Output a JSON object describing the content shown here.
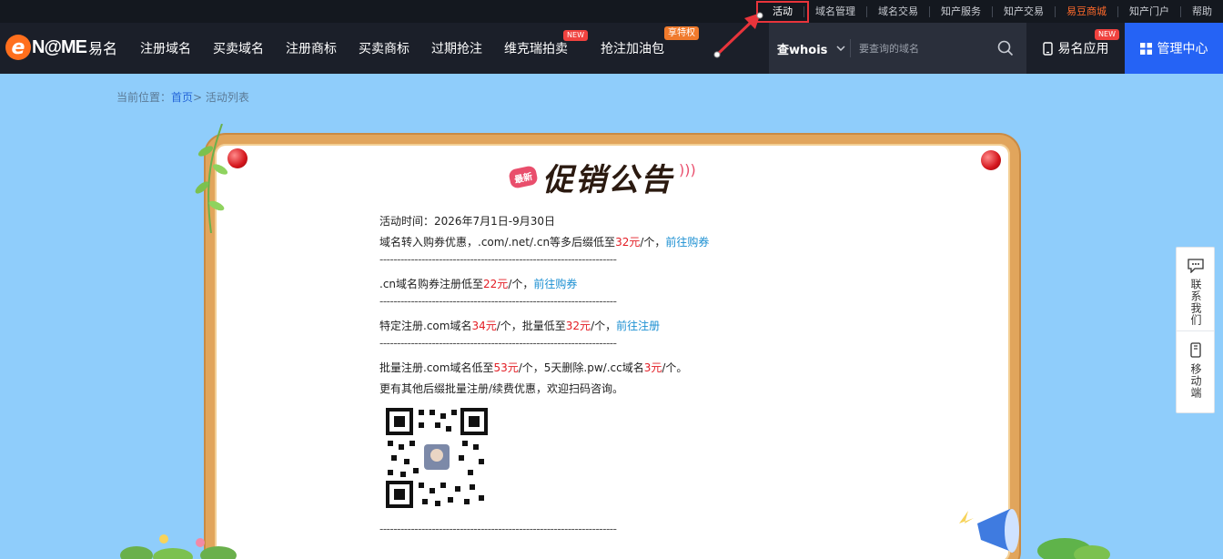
{
  "topbar": {
    "links": [
      {
        "label": "活动",
        "active": true
      },
      {
        "label": "域名管理"
      },
      {
        "label": "域名交易"
      },
      {
        "label": "知产服务"
      },
      {
        "label": "知产交易"
      },
      {
        "label": "易豆商城",
        "highlight": true
      },
      {
        "label": "知产门户"
      },
      {
        "label": "帮助"
      }
    ]
  },
  "logo": {
    "brand": "N@ME",
    "brand_cn": "易名",
    "letter": "e"
  },
  "nav": {
    "items": [
      {
        "label": "注册域名"
      },
      {
        "label": "买卖域名"
      },
      {
        "label": "注册商标"
      },
      {
        "label": "买卖商标"
      },
      {
        "label": "过期抢注"
      },
      {
        "label": "维克瑞拍卖",
        "badge": "NEW"
      },
      {
        "label": "抢注加油包",
        "badge": "享特权"
      }
    ]
  },
  "search": {
    "select_label": "查whois",
    "placeholder": "要查询的域名"
  },
  "app_button": {
    "label": "易名应用",
    "badge": "NEW"
  },
  "manage_button": {
    "label": "管理中心"
  },
  "breadcrumb": {
    "prefix": "当前位置：",
    "home": "首页",
    "separator": "> ",
    "current": "活动列表"
  },
  "notice": {
    "tag": "最新",
    "title": "促销公告",
    "period": "活动时间：2026年7月1日-9月30日",
    "transfer_a": "域名转入购券优惠，.com/.net/.cn等多后缀低至",
    "transfer_price": "32元",
    "transfer_b": "/个，",
    "transfer_link": "前往购券",
    "separator": "--------------------------------------------------------------------",
    "cn_a": ".cn域名购券注册低至",
    "cn_price": "22元",
    "cn_b": "/个，",
    "cn_link": "前往购券",
    "com_a": "特定注册.com域名",
    "com_price": "34元",
    "com_b": "/个，批量低至",
    "com_price2": "32元",
    "com_c": "/个，",
    "com_link": "前往注册",
    "bulk_a": "批量注册.com域名低至",
    "bulk_price": "53元",
    "bulk_b": "/个，5天删除.pw/.cc域名",
    "bulk_price2": "3元",
    "bulk_c": "/个。",
    "more": "更有其他后缀批量注册/续费优惠，欢迎扫码咨询。"
  },
  "side_float": {
    "contact": "联系我们",
    "mobile": "移动端"
  },
  "colors": {
    "accent": "#2563f5",
    "price": "#e31c23",
    "link": "#1b8fd2",
    "frame": "#e1a55c",
    "highlight": "#ff6a2b"
  }
}
